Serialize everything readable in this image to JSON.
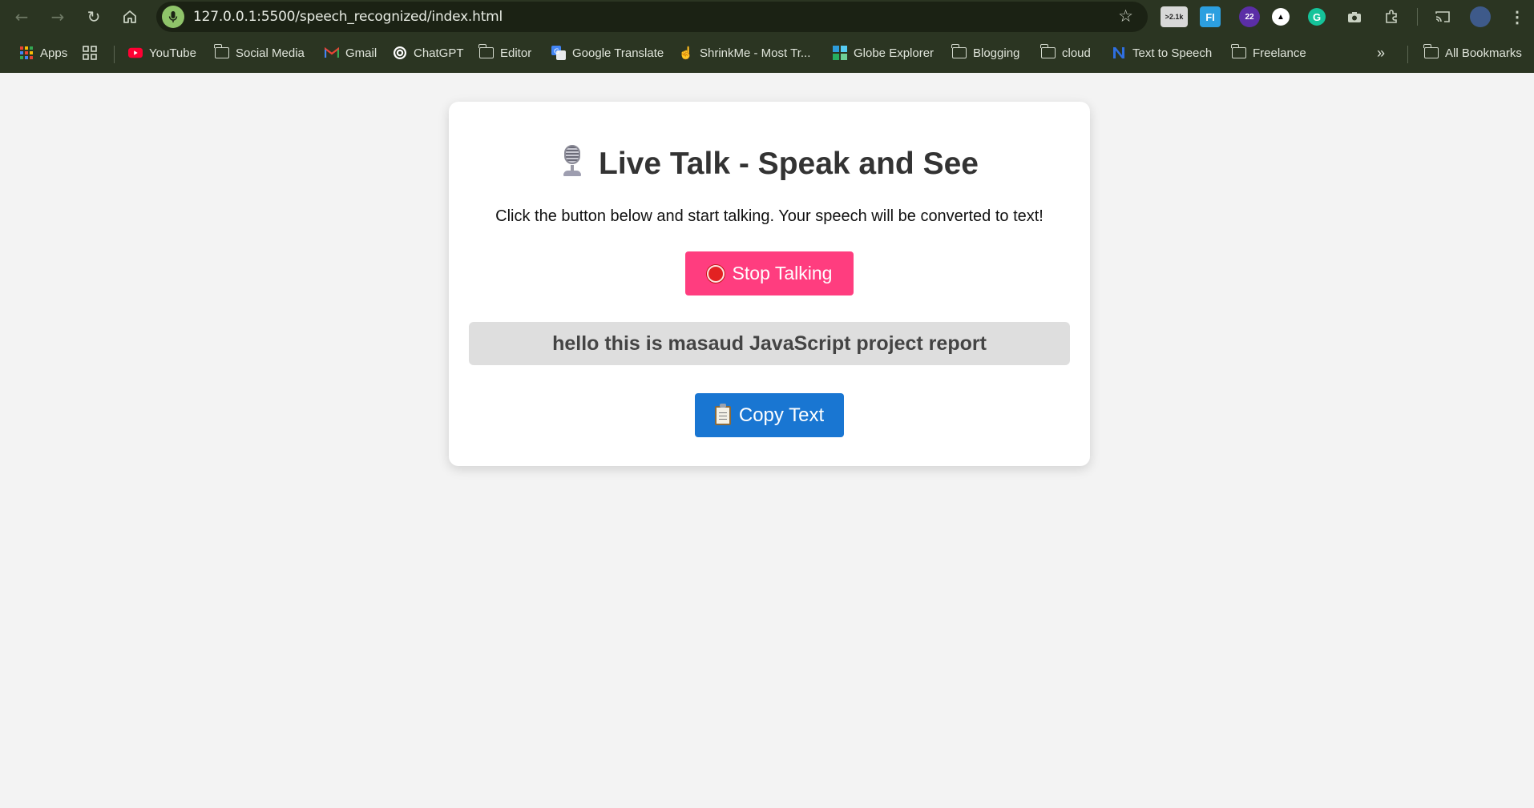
{
  "browser": {
    "url": "127.0.0.1:5500/speech_recognized/index.html",
    "extension_badge_1": ">2.1k",
    "extension_badge_2": "22",
    "extension_fi": "FI",
    "extension_grammarly": "G",
    "bookmarks": [
      {
        "label": "Apps",
        "icon": "apps-grid-icon"
      },
      {
        "label": "YouTube",
        "icon": "youtube-icon"
      },
      {
        "label": "Social Media",
        "icon": "folder-icon"
      },
      {
        "label": "Gmail",
        "icon": "gmail-icon"
      },
      {
        "label": "ChatGPT",
        "icon": "chatgpt-icon"
      },
      {
        "label": "Editor",
        "icon": "folder-icon"
      },
      {
        "label": "Google Translate",
        "icon": "translate-icon"
      },
      {
        "label": "ShrinkMe - Most Tr...",
        "icon": "hand-icon"
      },
      {
        "label": "Globe Explorer",
        "icon": "globe-explorer-icon"
      },
      {
        "label": "Blogging",
        "icon": "folder-icon"
      },
      {
        "label": "cloud",
        "icon": "folder-icon"
      },
      {
        "label": "Text to Speech",
        "icon": "text-to-speech-icon"
      },
      {
        "label": "Freelance",
        "icon": "folder-icon"
      }
    ],
    "all_bookmarks": "All Bookmarks",
    "overflow": "»"
  },
  "page": {
    "title": "Live Talk - Speak and See",
    "subtitle": "Click the button below and start talking. Your speech will be converted to text!",
    "stop_button_label": "Stop Talking",
    "output_text": "hello this is masaud JavaScript project report",
    "copy_button_label": "Copy Text"
  },
  "colors": {
    "stop_button": "#ff3d7f",
    "copy_button": "#1976d2",
    "output_bg": "#dedede",
    "page_bg": "#f3f3f3"
  }
}
